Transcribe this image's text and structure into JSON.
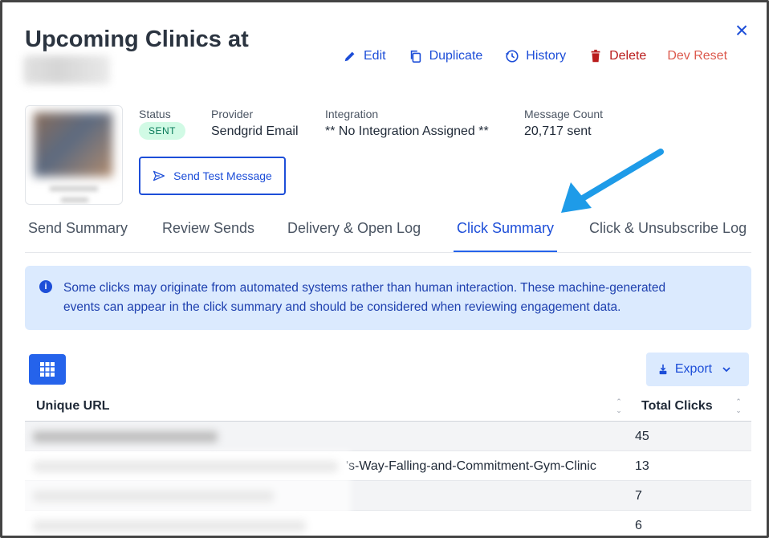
{
  "header": {
    "title": "Upcoming Clinics at",
    "close_label": "×"
  },
  "actions": [
    {
      "label": "Edit",
      "icon": "pencil-icon"
    },
    {
      "label": "Duplicate",
      "icon": "copy-icon"
    },
    {
      "label": "History",
      "icon": "history-icon"
    },
    {
      "label": "Delete",
      "icon": "trash-icon"
    },
    {
      "label": "Dev Reset"
    }
  ],
  "meta": {
    "status_label": "Status",
    "status_value": "SENT",
    "provider_label": "Provider",
    "provider_value": "Sendgrid Email",
    "integration_label": "Integration",
    "integration_value": "** No Integration Assigned **",
    "count_label": "Message Count",
    "count_value": "20,717 sent"
  },
  "test_button": {
    "label": "Send Test Message",
    "icon": "send-icon"
  },
  "tabs": [
    {
      "label": "Send Summary",
      "active": false
    },
    {
      "label": "Review Sends",
      "active": false
    },
    {
      "label": "Delivery & Open Log",
      "active": false
    },
    {
      "label": "Click Summary",
      "active": true
    },
    {
      "label": "Click & Unsubscribe Log",
      "active": false
    }
  ],
  "notice": {
    "icon": "info-icon",
    "line1": "Some clicks may originate from automated systems rather than human interaction. These machine-generated",
    "line2": "events can appear in the click summary and should be considered when reviewing engagement data."
  },
  "toolbar": {
    "grid_icon": "grid-icon",
    "export_label": "Export"
  },
  "table": {
    "columns": [
      "Unique URL",
      "Total Clicks"
    ],
    "rows": [
      {
        "url": "",
        "clicks": "45"
      },
      {
        "url": "'s-Way-Falling-and-Commitment-Gym-Clinic",
        "clicks": "13"
      },
      {
        "url": "",
        "clicks": "7"
      },
      {
        "url": "",
        "clicks": "6"
      }
    ]
  },
  "colors": {
    "accent": "#1d4ed8",
    "danger": "#b91c1c",
    "badge_bg": "#d1fae5",
    "notice_bg": "#dbeafe",
    "annotation_arrow": "#1e9be8"
  }
}
